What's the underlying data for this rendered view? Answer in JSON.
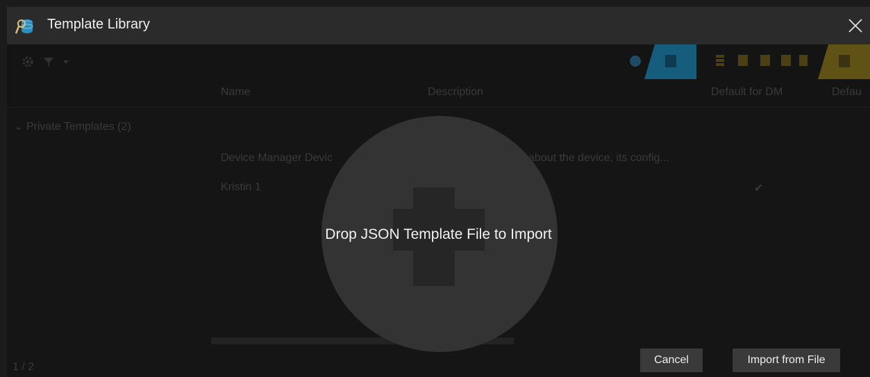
{
  "window": {
    "title": "Template Library",
    "icons": {
      "app": "template-library-icon",
      "close": "close-icon"
    }
  },
  "toolbar": {
    "left_icons": [
      "settings-icon",
      "filter-icon",
      "dropdown-arrow-icon"
    ],
    "right_icons": [
      "globe-icon",
      "template-icon",
      "stack-icon",
      "copy-icon",
      "import-icon",
      "export-icon",
      "delete-icon",
      "template-alt-icon"
    ]
  },
  "table": {
    "columns": [
      "Name",
      "Description",
      "Default for DM",
      "Defau"
    ],
    "group": "Private Templates (2)",
    "rows": [
      {
        "name": "Device Manager Devic",
        "description": "about the device, its config...",
        "default_for_dm": ""
      },
      {
        "name": "Kristin 1",
        "description": "",
        "default_for_dm": "✔"
      }
    ],
    "page_indicator": "1 / 2"
  },
  "overlay": {
    "message": "Drop JSON Template File to Import"
  },
  "buttons": {
    "cancel": "Cancel",
    "import": "Import from File"
  },
  "colors": {
    "titlebar": "#2b2b2b",
    "accent_blue": "#2e8fbf",
    "accent_yellow": "#c8a614"
  }
}
